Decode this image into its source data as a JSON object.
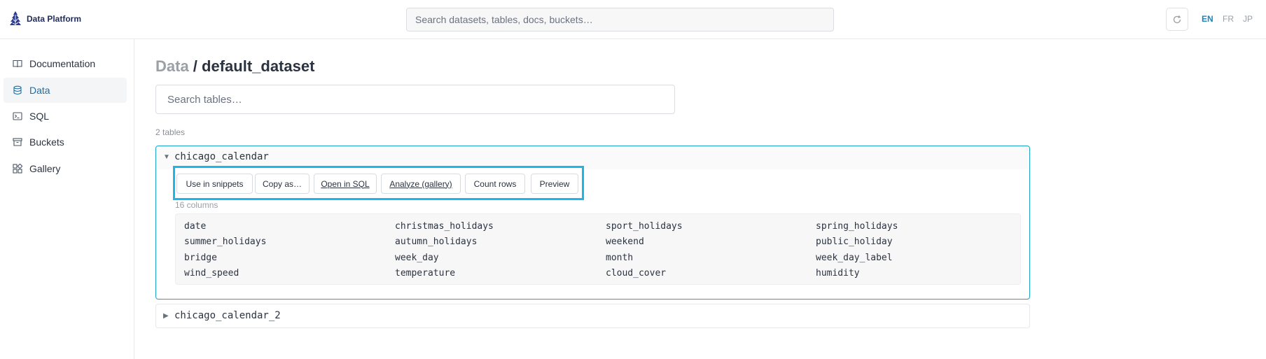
{
  "brand": {
    "name": "Data Platform"
  },
  "search": {
    "placeholder": "Search datasets, tables, docs, buckets…"
  },
  "languages": [
    "EN",
    "FR",
    "JP"
  ],
  "active_language": "EN",
  "sidebar": {
    "items": [
      {
        "label": "Documentation",
        "icon": "book-icon"
      },
      {
        "label": "Data",
        "icon": "database-icon",
        "active": true
      },
      {
        "label": "SQL",
        "icon": "terminal-icon"
      },
      {
        "label": "Buckets",
        "icon": "archive-icon"
      },
      {
        "label": "Gallery",
        "icon": "gallery-icon"
      }
    ]
  },
  "main": {
    "breadcrumb_root": "Data",
    "separator": " / ",
    "dataset": "default_dataset",
    "table_search_placeholder": "Search tables…",
    "table_count": "2 tables",
    "tables": [
      {
        "name": "chicago_calendar",
        "expanded": true,
        "actions": [
          "Use in snippets",
          "Copy as…",
          "Open in SQL",
          "Analyze (gallery)",
          "Count rows",
          "Preview"
        ],
        "columns_label": "16 columns",
        "columns": [
          [
            "date",
            "christmas_holidays",
            "sport_holidays",
            "spring_holidays"
          ],
          [
            "summer_holidays",
            "autumn_holidays",
            "weekend",
            "public_holiday"
          ],
          [
            "bridge",
            "week_day",
            "month",
            "week_day_label"
          ],
          [
            "wind_speed",
            "temperature",
            "cloud_cover",
            "humidity"
          ]
        ]
      },
      {
        "name": "chicago_calendar_2",
        "expanded": false
      }
    ]
  },
  "colors": {
    "accent": "#1a86b8",
    "highlight": "#18b8e8",
    "card_border": "#1aa5c8"
  }
}
